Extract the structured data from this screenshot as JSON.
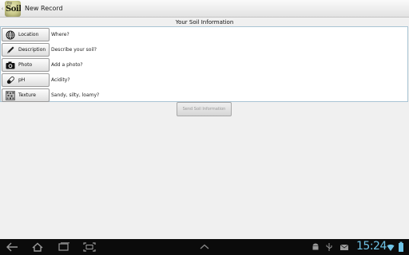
{
  "action_bar": {
    "logo_small_text": "my",
    "logo_text": "Soil",
    "title": "New Record"
  },
  "section": {
    "header": "Your Soil Information"
  },
  "rows": [
    {
      "button_label": "Location",
      "icon": "globe-icon",
      "value": "Where?"
    },
    {
      "button_label": "Description",
      "icon": "pencil-icon",
      "value": "Describe your soil?"
    },
    {
      "button_label": "Photo",
      "icon": "camera-icon",
      "value": "Add a photo?"
    },
    {
      "button_label": "pH",
      "icon": "test-tube-icon",
      "value": "Acidity?"
    },
    {
      "button_label": "Texture",
      "icon": "texture-icon",
      "value": "Sandy, silty, loamy?"
    }
  ],
  "send_button": {
    "label": "Send Soil Information",
    "enabled": false
  },
  "system_bar": {
    "clock": "15:24",
    "nav_icons": [
      "back-icon",
      "home-icon",
      "recent-apps-icon",
      "screenshot-icon",
      "up-chevron-icon"
    ],
    "status_icons": [
      "android-icon",
      "usb-icon",
      "email-icon",
      "wifi-icon",
      "battery-icon"
    ],
    "clock_color": "#6fc3e6"
  },
  "colors": {
    "panel_border": "#a9c4d4",
    "background": "#f0f0f0"
  }
}
